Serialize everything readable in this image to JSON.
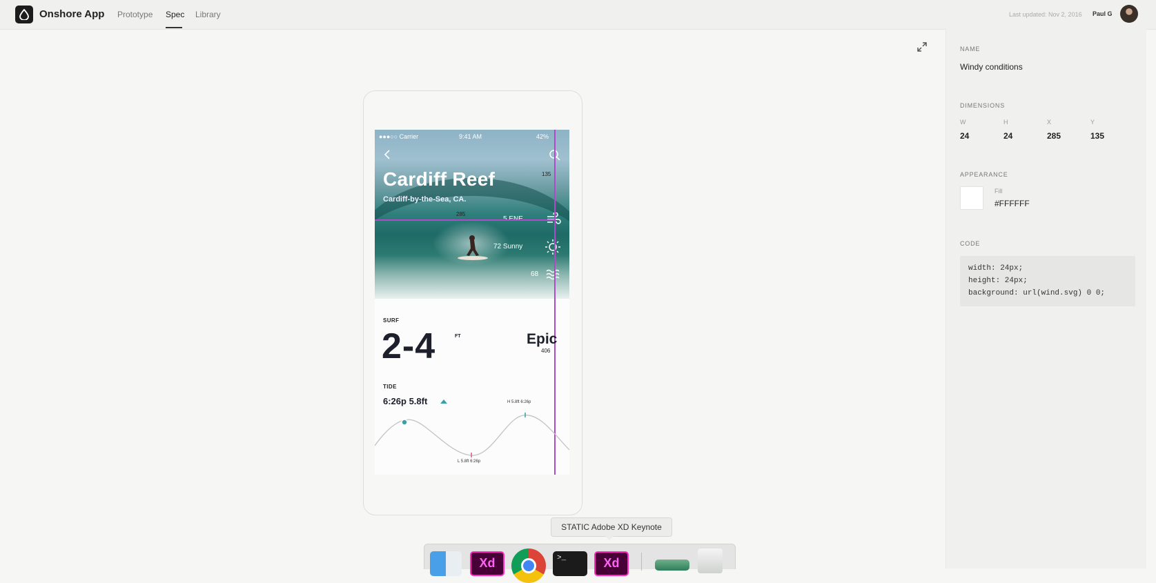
{
  "header": {
    "app_title": "Onshore App",
    "tabs": [
      {
        "label": "Prototype",
        "active": false
      },
      {
        "label": "Spec",
        "active": true
      },
      {
        "label": "Library",
        "active": false
      }
    ],
    "last_updated": "Last updated: Nov 2, 2016",
    "user_name": "Paul G"
  },
  "artboard": {
    "status": {
      "carrier": "●●●○○ Carrier",
      "time": "9:41 AM",
      "battery": "42%"
    },
    "title": "Cardiff Reef",
    "subtitle": "Cardiff-by-the-Sea, CA.",
    "conditions": {
      "wind": "5 ENE",
      "weather": "72 Sunny",
      "water": "68"
    },
    "surf": {
      "label": "SURF",
      "value": "2-4",
      "unit": "FT",
      "rating": "Epic"
    },
    "tide": {
      "label": "TIDE",
      "value": "6:26p 5.8ft",
      "high": "H 5.8ft 6:26p",
      "low": "L 5.8ft 6:26p"
    },
    "measurements": {
      "top": "135",
      "left": "285",
      "right": "406"
    }
  },
  "inspector": {
    "name_label": "NAME",
    "name_value": "Windy conditions",
    "dimensions_label": "DIMENSIONS",
    "dims": [
      {
        "label": "W",
        "value": "24"
      },
      {
        "label": "H",
        "value": "24"
      },
      {
        "label": "X",
        "value": "285"
      },
      {
        "label": "Y",
        "value": "135"
      }
    ],
    "appearance_label": "APPEARANCE",
    "fill_label": "Fill",
    "fill_value": "#FFFFFF",
    "code_label": "CODE",
    "code_lines": [
      "width: 24px;",
      "height: 24px;",
      "background: url(wind.svg) 0 0;"
    ]
  },
  "tooltip": "STATIC Adobe XD Keynote",
  "dock": {
    "xd_label": "Xd",
    "terminal_prompt": ">_"
  },
  "colors": {
    "guide": "#b14ac8",
    "accent": "#38a0a6",
    "xd_border": "#ff2bc2",
    "xd_bg": "#470137"
  }
}
